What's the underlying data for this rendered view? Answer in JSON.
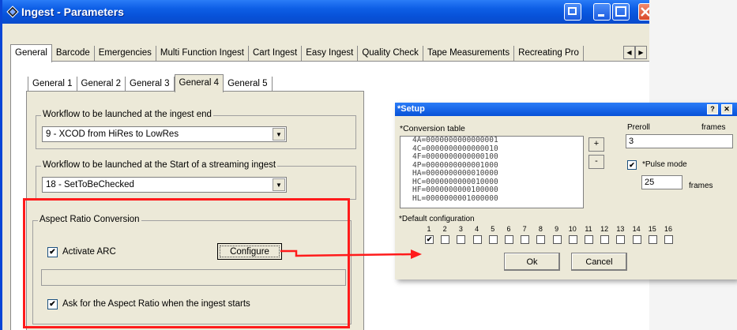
{
  "window": {
    "title": "Ingest - Parameters"
  },
  "main_tabs": [
    "General",
    "Barcode",
    "Emergencies",
    "Multi Function Ingest",
    "Cart Ingest",
    "Easy Ingest",
    "Quality Check",
    "Tape Measurements",
    "Recreating Pro"
  ],
  "sub_tabs": [
    "General 1",
    "General 2",
    "General 3",
    "General 4",
    "General 5"
  ],
  "workflow_end": {
    "label": "Workflow to be launched at the ingest end",
    "value": "9 - XCOD from HiRes to LowRes"
  },
  "workflow_start": {
    "label": "Workflow to be launched at the Start of a streaming ingest",
    "value": "18 - SetToBeChecked"
  },
  "arc": {
    "label": "Aspect Ratio Conversion",
    "activate_label": "Activate ARC",
    "activate_checked": "✔",
    "configure_label": "Configure",
    "ask_label": "Ask for the Aspect Ratio when the ingest starts",
    "ask_checked": "✔"
  },
  "setup": {
    "title": "*Setup",
    "help": "?",
    "close": "✕",
    "conversion_label": "*Conversion table",
    "conversion_rows": [
      "4A=0000000000000001",
      "4C=0000000000000010",
      "4F=0000000000000100",
      "4P=0000000000001000",
      "HA=0000000000010000",
      "HC=0000000000010000",
      "HF=0000000000100000",
      "HL=0000000001000000"
    ],
    "add_label": "+",
    "remove_label": "-",
    "preroll_label": "Preroll",
    "preroll_unit": "frames",
    "preroll_value": "3",
    "pulse_label": "*Pulse mode",
    "pulse_checked": "✔",
    "pulse_value": "25",
    "pulse_unit": "frames",
    "default_label": "*Default configuration",
    "config_numbers": [
      "1",
      "2",
      "3",
      "4",
      "5",
      "6",
      "7",
      "8",
      "9",
      "10",
      "11",
      "12",
      "13",
      "14",
      "15",
      "16"
    ],
    "config_checks": [
      "✔",
      "",
      "",
      "",
      "",
      "",
      "",
      "",
      "",
      "",
      "",
      "",
      "",
      "",
      "",
      ""
    ],
    "ok_label": "Ok",
    "cancel_label": "Cancel"
  },
  "colors": {
    "titlebar": "#0751d8",
    "highlight": "#ff1b1b",
    "face": "#ece9d8"
  }
}
